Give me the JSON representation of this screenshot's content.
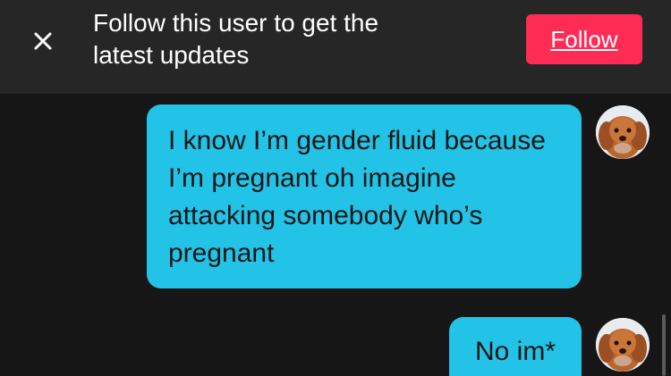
{
  "banner": {
    "text": "Follow this user to get the\nlatest updates",
    "follow_label": "Follow",
    "close_icon": "close-icon"
  },
  "messages": [
    {
      "text": "I know I’m gender fluid because I’m pregnant oh imagine attacking somebody who’s pregnant",
      "avatar_icon": "dog-avatar-icon"
    },
    {
      "text": "No im*",
      "avatar_icon": "dog-avatar-icon"
    }
  ],
  "colors": {
    "background": "#161616",
    "banner_background": "#262626",
    "follow_button": "#fe2c55",
    "bubble": "#22c3e6",
    "bubble_text": "#161616"
  }
}
